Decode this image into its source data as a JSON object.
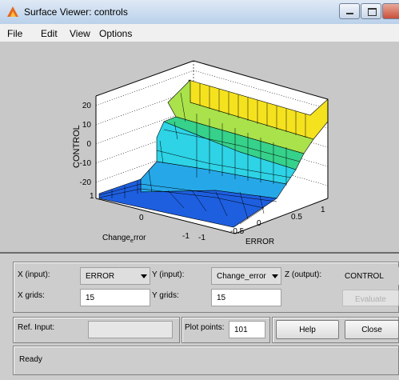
{
  "window": {
    "title": "Surface Viewer: controls"
  },
  "menu": [
    "File",
    "Edit",
    "View",
    "Options"
  ],
  "axes": {
    "zlabel": "CONTROL",
    "xlabel": "ERROR",
    "ylabel_main": "Change",
    "ylabel_sub": "e",
    "ylabel_tail": "rror",
    "z_ticks": [
      "20",
      "10",
      "0",
      "-10",
      "-20"
    ],
    "error_ticks": [
      "1",
      "0.5",
      "0",
      "-0.5",
      "-1"
    ],
    "change_ticks": [
      "1",
      "0",
      "-1"
    ]
  },
  "controls": {
    "x_input_label": "X (input):",
    "x_input_value": "ERROR",
    "y_input_label": "Y (input):",
    "y_input_value": "Change_error",
    "z_output_label": "Z (output):",
    "z_output_value": "CONTROL",
    "x_grids_label": "X grids:",
    "x_grids_value": "15",
    "y_grids_label": "Y grids:",
    "y_grids_value": "15",
    "evaluate_label": "Evaluate",
    "ref_input_label": "Ref. Input:",
    "ref_input_value": "",
    "plot_points_label": "Plot points:",
    "plot_points_value": "101",
    "help_label": "Help",
    "close_label": "Close",
    "status": "Ready"
  }
}
